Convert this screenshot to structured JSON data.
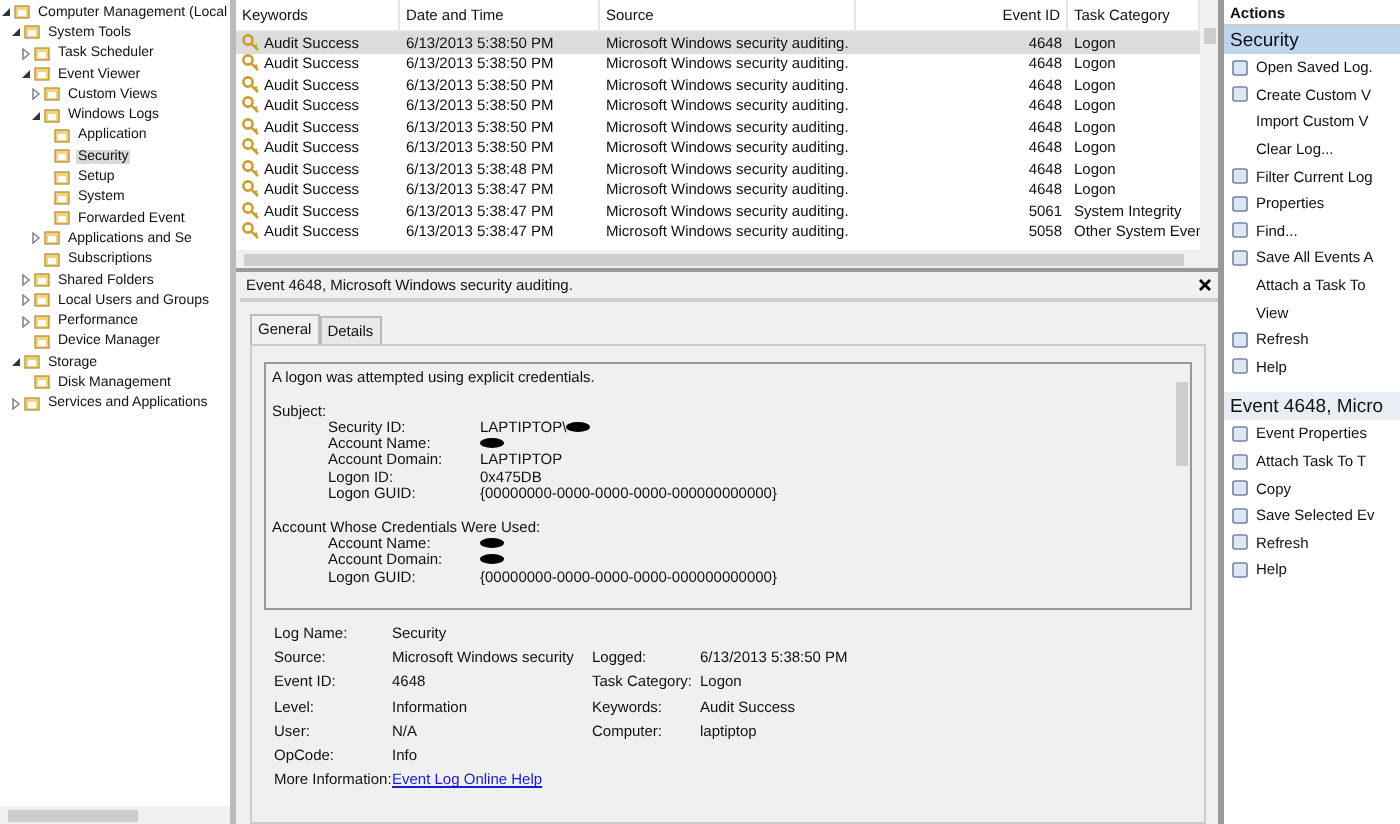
{
  "tree": [
    {
      "label": "Computer Management (Local",
      "kind": "branch",
      "expanded": true,
      "selected": false,
      "children": [
        {
          "label": "System Tools",
          "kind": "branch",
          "expanded": true,
          "selected": false,
          "children": [
            {
              "label": "Task Scheduler",
              "kind": "branch",
              "expanded": false,
              "selected": false
            },
            {
              "label": "Event Viewer",
              "kind": "branch",
              "expanded": true,
              "selected": false,
              "children": [
                {
                  "label": "Custom Views",
                  "kind": "branch",
                  "expanded": false,
                  "selected": false
                },
                {
                  "label": "Windows Logs",
                  "kind": "branch",
                  "expanded": true,
                  "selected": false,
                  "children": [
                    {
                      "label": "Application",
                      "kind": "leaf",
                      "selected": false
                    },
                    {
                      "label": "Security",
                      "kind": "leaf",
                      "selected": true
                    },
                    {
                      "label": "Setup",
                      "kind": "leaf",
                      "selected": false
                    },
                    {
                      "label": "System",
                      "kind": "leaf",
                      "selected": false
                    },
                    {
                      "label": "Forwarded Event",
                      "kind": "leaf",
                      "selected": false
                    }
                  ]
                },
                {
                  "label": "Applications and Se",
                  "kind": "branch",
                  "expanded": false,
                  "selected": false
                },
                {
                  "label": "Subscriptions",
                  "kind": "leaf",
                  "selected": false
                }
              ]
            },
            {
              "label": "Shared Folders",
              "kind": "branch",
              "expanded": false,
              "selected": false
            },
            {
              "label": "Local Users and Groups",
              "kind": "branch",
              "expanded": false,
              "selected": false
            },
            {
              "label": "Performance",
              "kind": "branch",
              "expanded": false,
              "selected": false
            },
            {
              "label": "Device Manager",
              "kind": "leaf",
              "selected": false
            }
          ]
        },
        {
          "label": "Storage",
          "kind": "branch",
          "expanded": true,
          "selected": false,
          "children": [
            {
              "label": "Disk Management",
              "kind": "leaf",
              "selected": false
            }
          ]
        },
        {
          "label": "Services and Applications",
          "kind": "branch",
          "expanded": false,
          "selected": false
        }
      ]
    }
  ],
  "table": {
    "columns": [
      "Keywords",
      "Date and Time",
      "Source",
      "Event ID",
      "Task Category"
    ],
    "rows": [
      {
        "cells": [
          "Audit Success",
          "6/13/2013 5:38:50 PM",
          "Microsoft Windows security auditing.",
          "4648",
          "Logon"
        ],
        "selected": true
      },
      {
        "cells": [
          "Audit Success",
          "6/13/2013 5:38:50 PM",
          "Microsoft Windows security auditing.",
          "4648",
          "Logon"
        ],
        "selected": false
      },
      {
        "cells": [
          "Audit Success",
          "6/13/2013 5:38:50 PM",
          "Microsoft Windows security auditing.",
          "4648",
          "Logon"
        ],
        "selected": false
      },
      {
        "cells": [
          "Audit Success",
          "6/13/2013 5:38:50 PM",
          "Microsoft Windows security auditing.",
          "4648",
          "Logon"
        ],
        "selected": false
      },
      {
        "cells": [
          "Audit Success",
          "6/13/2013 5:38:50 PM",
          "Microsoft Windows security auditing.",
          "4648",
          "Logon"
        ],
        "selected": false
      },
      {
        "cells": [
          "Audit Success",
          "6/13/2013 5:38:50 PM",
          "Microsoft Windows security auditing.",
          "4648",
          "Logon"
        ],
        "selected": false
      },
      {
        "cells": [
          "Audit Success",
          "6/13/2013 5:38:48 PM",
          "Microsoft Windows security auditing.",
          "4648",
          "Logon"
        ],
        "selected": false
      },
      {
        "cells": [
          "Audit Success",
          "6/13/2013 5:38:47 PM",
          "Microsoft Windows security auditing.",
          "4648",
          "Logon"
        ],
        "selected": false
      },
      {
        "cells": [
          "Audit Success",
          "6/13/2013 5:38:47 PM",
          "Microsoft Windows security auditing.",
          "5061",
          "System Integrity"
        ],
        "selected": false
      },
      {
        "cells": [
          "Audit Success",
          "6/13/2013 5:38:47 PM",
          "Microsoft Windows security auditing.",
          "5058",
          "Other System Even"
        ],
        "selected": false
      }
    ]
  },
  "detail": {
    "title": "Event 4648, Microsoft Windows security auditing.",
    "tabs": [
      {
        "label": "General",
        "selected": true
      },
      {
        "label": "Details",
        "selected": false
      }
    ],
    "description": "A logon was attempted using explicit credentials.",
    "sections": [
      {
        "heading": "Subject:",
        "fields": [
          {
            "label": "Security ID:",
            "value": "LAPTIPTOP\\",
            "redacted": true
          },
          {
            "label": "Account Name:",
            "redacted": true
          },
          {
            "label": "Account Domain:",
            "value": "LAPTIPTOP"
          },
          {
            "label": "Logon ID:",
            "value": "0x475DB"
          },
          {
            "label": "Logon GUID:",
            "value": "{00000000-0000-0000-0000-000000000000}"
          }
        ]
      },
      {
        "heading": "Account Whose Credentials Were Used:",
        "fields": [
          {
            "label": "Account Name:",
            "redacted": true
          },
          {
            "label": "Account Domain:",
            "redacted": true
          },
          {
            "label": "Logon GUID:",
            "value": "{00000000-0000-0000-0000-000000000000}"
          }
        ]
      }
    ],
    "properties": [
      {
        "label": "Log Name:",
        "value": "Security"
      },
      {
        "label": "Source:",
        "value": "Microsoft Windows security",
        "label_2": "Logged:",
        "value_2": "6/13/2013 5:38:50 PM"
      },
      {
        "label": "Event ID:",
        "value": "4648",
        "label_2": "Task Category:",
        "value_2": "Logon"
      },
      {
        "label": "Level:",
        "value": "Information",
        "label_2": "Keywords:",
        "value_2": "Audit Success"
      },
      {
        "label": "User:",
        "value": "N/A",
        "label_2": "Computer:",
        "value_2": "laptiptop"
      },
      {
        "label": "OpCode:",
        "value": "Info"
      },
      {
        "label": "More Information:",
        "link": "Event Log Online Help"
      }
    ]
  },
  "actions": {
    "title": "Actions",
    "sections": [
      {
        "heading": "Security",
        "selected": true,
        "items": [
          {
            "label": "Open Saved Log.",
            "kind": "icon"
          },
          {
            "label": "Create Custom V",
            "kind": "icon"
          },
          {
            "label": "Import Custom V",
            "kind": "text"
          },
          {
            "label": "Clear Log...",
            "kind": "text"
          },
          {
            "label": "Filter Current Log",
            "kind": "icon"
          },
          {
            "label": "Properties",
            "kind": "icon"
          },
          {
            "label": "Find...",
            "kind": "icon"
          },
          {
            "label": "Save All Events A",
            "kind": "icon"
          },
          {
            "label": "Attach a Task To",
            "kind": "text"
          },
          {
            "label": "View",
            "kind": "text"
          },
          {
            "label": "Refresh",
            "kind": "icon"
          },
          {
            "label": "Help",
            "kind": "icon"
          }
        ]
      },
      {
        "heading": "Event 4648, Micro",
        "selected": false,
        "items": [
          {
            "label": "Event Properties",
            "kind": "icon"
          },
          {
            "label": "Attach Task To T",
            "kind": "icon"
          },
          {
            "label": "Copy",
            "kind": "icon"
          },
          {
            "label": "Save Selected Ev",
            "kind": "icon"
          },
          {
            "label": "Refresh",
            "kind": "icon"
          },
          {
            "label": "Help",
            "kind": "icon"
          }
        ]
      }
    ]
  }
}
